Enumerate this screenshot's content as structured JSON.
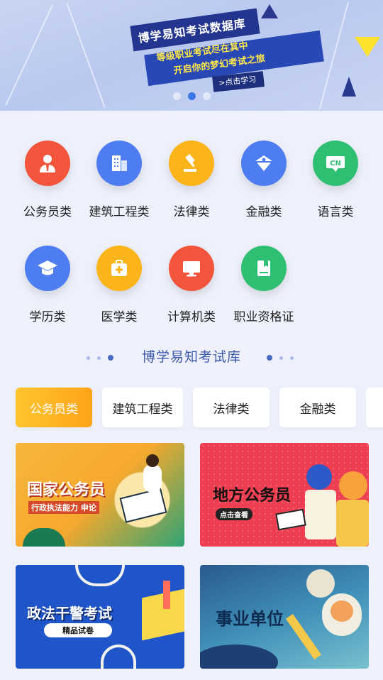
{
  "banner": {
    "title": "博学易知考试数据库",
    "line1": "等级职业考试尽在其中",
    "line2": "开启你的梦幻考试之旅",
    "button": ">点击学习",
    "page_count": 3,
    "active_page": 2
  },
  "categories": [
    {
      "label": "公务员类",
      "icon": "civil-servant-icon",
      "color": "#f2553c"
    },
    {
      "label": "建筑工程类",
      "icon": "building-icon",
      "color": "#4d7df0"
    },
    {
      "label": "法律类",
      "icon": "gavel-icon",
      "color": "#fbb419"
    },
    {
      "label": "金融类",
      "icon": "finance-icon",
      "color": "#4d7df0"
    },
    {
      "label": "语言类",
      "icon": "cn-language-icon",
      "color": "#2fbf73"
    },
    {
      "label": "学历类",
      "icon": "graduation-cap-icon",
      "color": "#4d7df0"
    },
    {
      "label": "医学类",
      "icon": "medical-kit-icon",
      "color": "#fbb419"
    },
    {
      "label": "计算机类",
      "icon": "computer-icon",
      "color": "#f2553c"
    },
    {
      "label": "职业资格证",
      "icon": "certificate-icon",
      "color": "#2fbf73"
    }
  ],
  "section": {
    "title": "博学易知考试库"
  },
  "tabs": [
    {
      "label": "公务员类",
      "active": true
    },
    {
      "label": "建筑工程类",
      "active": false
    },
    {
      "label": "法律类",
      "active": false
    },
    {
      "label": "金融类",
      "active": false
    }
  ],
  "cards": [
    {
      "title": "国家公务员",
      "subtitle": "行政执法能力 申论"
    },
    {
      "title": "地方公务员",
      "badge": "点击查看"
    },
    {
      "title": "政法干警考试",
      "badge": "精品试卷"
    },
    {
      "title": "事业单位"
    }
  ],
  "colors": {
    "accent": "#3b76e6",
    "tab_active": "#ffa41b",
    "section_title": "#3d5aa8"
  }
}
